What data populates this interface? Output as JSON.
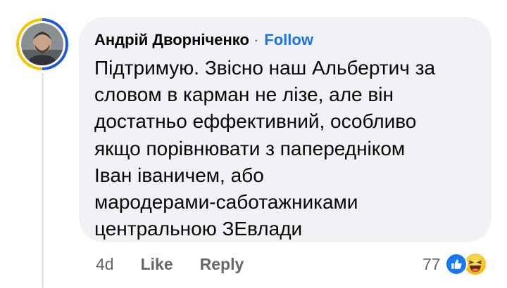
{
  "comment": {
    "author": "Андрій Дворніченко",
    "separator": "·",
    "follow_label": "Follow",
    "lines": [
      "Підтримую. Звісно наш Альбертич за",
      "словом в карман не лізе, але він",
      "достатньо еффективний, особливо",
      "якщо порівнювати з папередніком",
      "Іван іваничем, або",
      "мародерами-саботажниками",
      "центральною ЗЕвлади"
    ]
  },
  "actions": {
    "time": "4d",
    "like_label": "Like",
    "reply_label": "Reply"
  },
  "reactions": {
    "count": "77",
    "icons": [
      "like-icon",
      "haha-icon"
    ]
  },
  "colors": {
    "bubble": "#f0f2f5",
    "follow": "#1b74e4",
    "meta": "#65676b",
    "like": "#1877f2",
    "ring_blue": "#1f5ad6",
    "ring_yellow": "#f5c400"
  }
}
